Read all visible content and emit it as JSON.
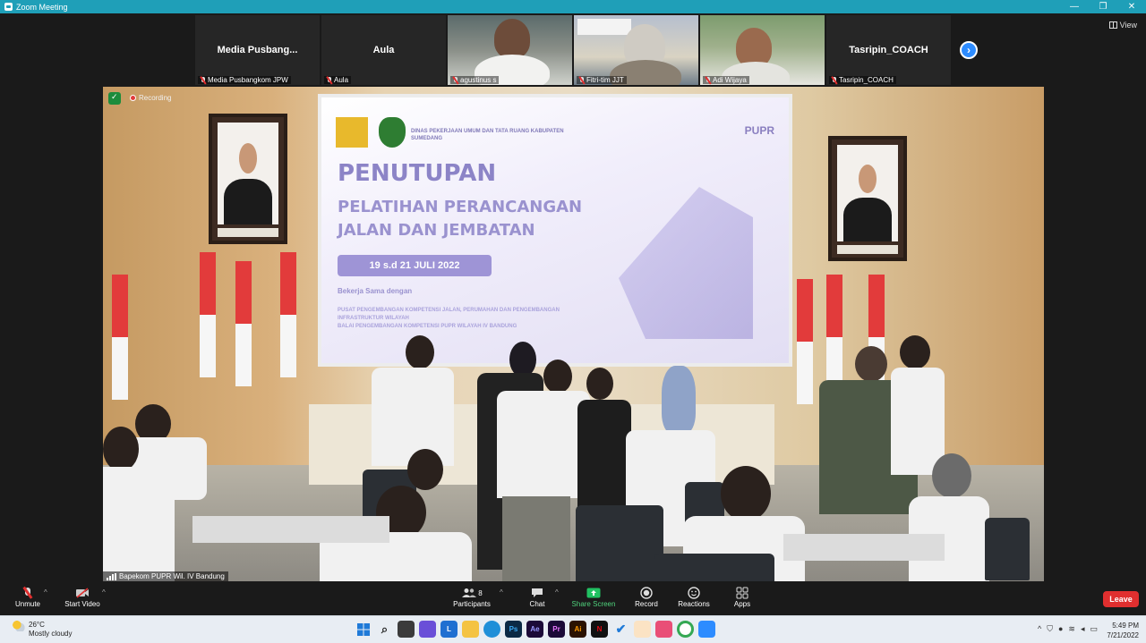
{
  "window": {
    "title": "Zoom Meeting"
  },
  "view_button": {
    "label": "View"
  },
  "participants_strip": [
    {
      "display": "Media  Pusbang...",
      "caption": "Media Pusbangkom JPW",
      "video": false
    },
    {
      "display": "Aula",
      "caption": "Aula",
      "video": false
    },
    {
      "display": "",
      "caption": "agustinus s",
      "video": true
    },
    {
      "display": "",
      "caption": "Fitri-tim JJT",
      "video": true
    },
    {
      "display": "",
      "caption": "Adi Wijaya",
      "video": true
    },
    {
      "display": "Tasripin_COACH",
      "caption": "Tasripin_COACH",
      "video": false
    }
  ],
  "main_video": {
    "recording_label": "Recording",
    "speaker_caption": "Bapekom PUPR Wil. IV Bandung",
    "slide": {
      "org": "DINAS PEKERJAAN UMUM DAN TATA RUANG KABUPATEN SUMEDANG",
      "brand": "PUPR",
      "heading": "PENUTUPAN",
      "subheading_1": "PELATIHAN PERANCANGAN",
      "subheading_2": "JALAN DAN JEMBATAN",
      "date": "19 s.d 21 JULI 2022",
      "cooperation": "Bekerja Sama dengan",
      "partner_1": "PUSAT PENGEMBANGAN KOMPETENSI JALAN, PERUMAHAN DAN PENGEMBANGAN INFRASTRUKTUR WILAYAH",
      "partner_2": "BALAI PENGEMBANGAN KOMPETENSI PUPR WILAYAH IV BANDUNG"
    }
  },
  "toolbar": {
    "unmute": "Unmute",
    "start_video": "Start Video",
    "participants": "Participants",
    "participants_count": "8",
    "chat": "Chat",
    "share_screen": "Share Screen",
    "record": "Record",
    "reactions": "Reactions",
    "apps": "Apps",
    "leave": "Leave"
  },
  "taskbar": {
    "temperature": "26°C",
    "condition": "Mostly cloudy",
    "time": "5:49 PM",
    "date": "7/21/2022"
  },
  "colors": {
    "zoom_blue": "#2d8cff",
    "titlebar": "#1f9fb8",
    "leave_red": "#e02f2f",
    "share_green": "#21c162"
  }
}
